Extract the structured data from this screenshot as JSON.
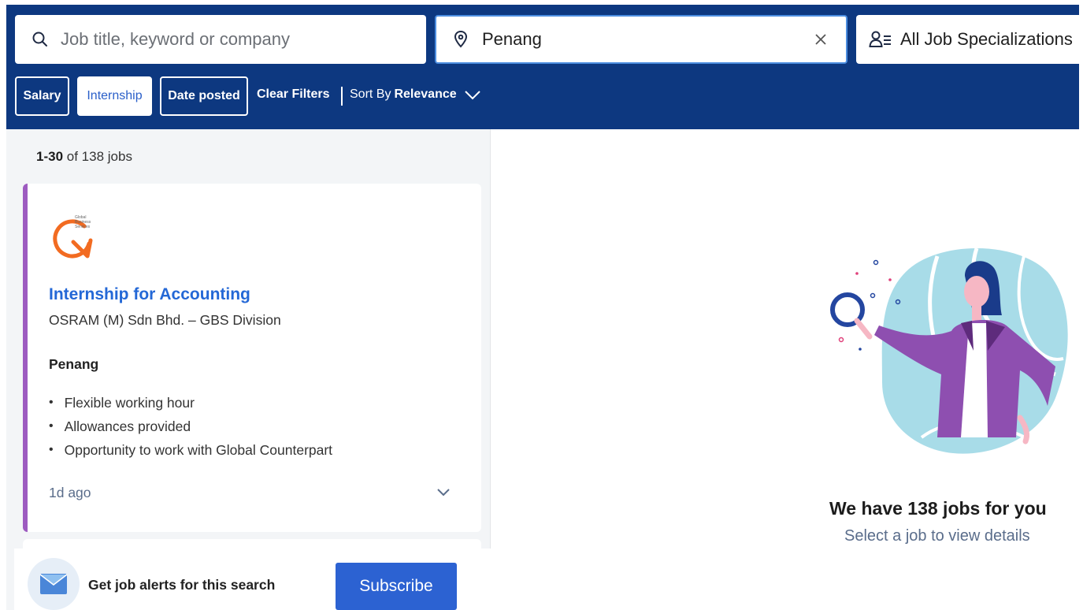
{
  "search": {
    "keyword_placeholder": "Job title, keyword or company",
    "location_value": "Penang",
    "specialization_label": "All Job Specializations"
  },
  "filters": {
    "salary": "Salary",
    "internship": "Internship",
    "date_posted": "Date posted",
    "clear": "Clear Filters",
    "sort_prefix": "Sort By",
    "sort_value": "Relevance"
  },
  "results": {
    "range": "1-30",
    "total_text": "of 138 jobs"
  },
  "job": {
    "title": "Internship for Accounting",
    "company": "OSRAM (M) Sdn Bhd. – GBS Division",
    "location": "Penang",
    "highlights": [
      "Flexible working hour",
      "Allowances provided",
      "Opportunity to work with Global Counterpart"
    ],
    "posted": "1d ago",
    "logo_text": [
      "Global",
      "Business",
      "Services"
    ]
  },
  "alert": {
    "text": "Get job alerts for this search",
    "button": "Subscribe"
  },
  "empty_state": {
    "title": "We have 138 jobs for you",
    "subtitle": "Select a job to view details"
  },
  "colors": {
    "header_bg": "#0d3880",
    "accent_blue": "#2468d6",
    "card_stripe": "#9d5bc0",
    "subscribe_bg": "#2c62d2"
  }
}
